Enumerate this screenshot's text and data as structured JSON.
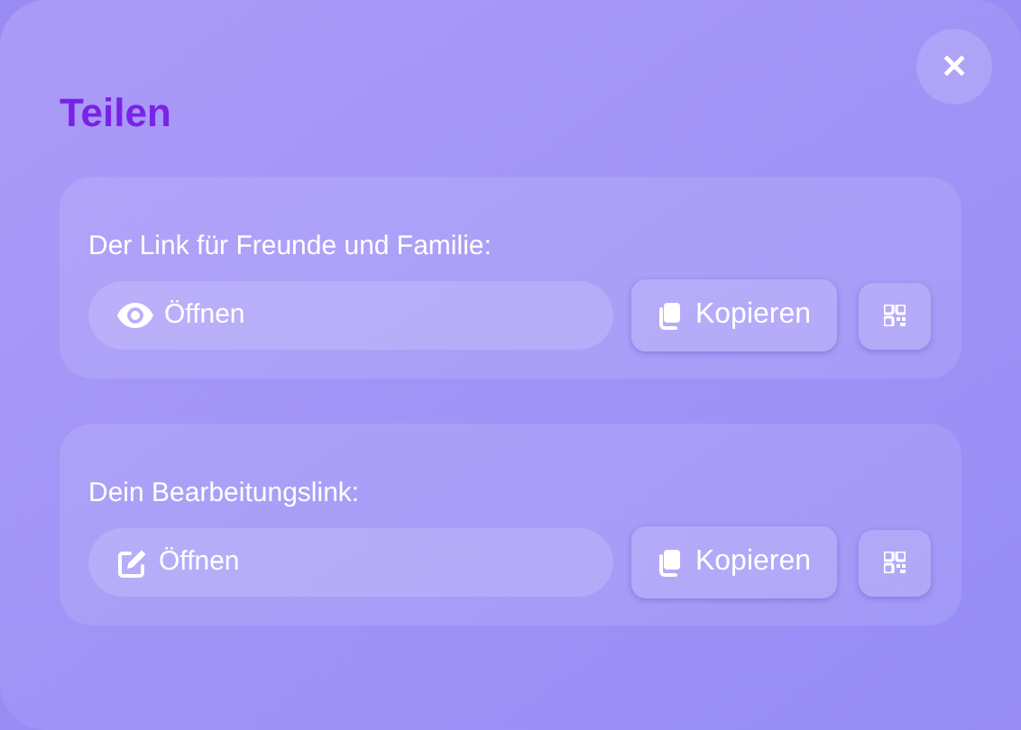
{
  "dialog": {
    "title": "Teilen",
    "close": "✕"
  },
  "links": [
    {
      "label": "Der Link für Freunde und Familie:",
      "kind": "view",
      "open": "Öffnen",
      "copy": "Kopieren"
    },
    {
      "label": "Dein Bearbeitungslink:",
      "kind": "edit",
      "open": "Öffnen",
      "copy": "Kopieren"
    }
  ]
}
